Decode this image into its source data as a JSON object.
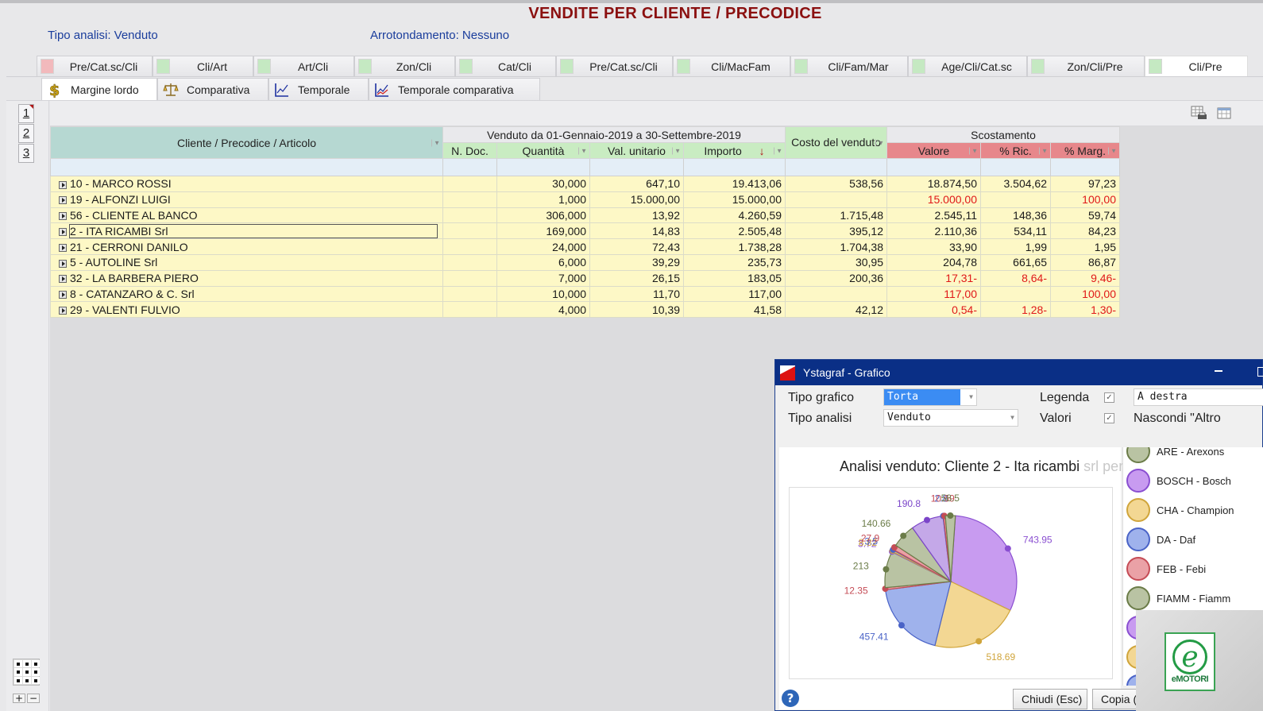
{
  "header": {
    "title": "VENDITE PER CLIENTE / PRECODICE",
    "tipo_analisi": "Tipo analisi: Venduto",
    "arrotondamento": "Arrotondamento: Nessuno"
  },
  "view_tabs": [
    {
      "label": "Pre/Cat.sc/Cli",
      "color": "#f2b9bc",
      "active": false
    },
    {
      "label": "Cli/Art",
      "color": "#c5e9c2",
      "active": false
    },
    {
      "label": "Art/Cli",
      "color": "#c5e9c2",
      "active": false
    },
    {
      "label": "Zon/Cli",
      "color": "#c5e9c2",
      "active": false
    },
    {
      "label": "Cat/Cli",
      "color": "#c5e9c2",
      "active": false
    },
    {
      "label": "Pre/Cat.sc/Cli",
      "color": "#c5e9c2",
      "active": false
    },
    {
      "label": "Cli/MacFam",
      "color": "#c5e9c2",
      "active": false
    },
    {
      "label": "Cli/Fam/Mar",
      "color": "#c5e9c2",
      "active": false
    },
    {
      "label": "Age/Cli/Cat.sc",
      "color": "#c5e9c2",
      "active": false
    },
    {
      "label": "Zon/Cli/Pre",
      "color": "#c5e9c2",
      "active": false
    },
    {
      "label": "Cli/Pre",
      "color": "#c5e9c2",
      "active": true
    }
  ],
  "analysis_tabs": [
    {
      "label": "Margine lordo",
      "icon": "dollar-icon",
      "active": true
    },
    {
      "label": "Comparativa",
      "icon": "scales-icon",
      "active": false
    },
    {
      "label": "Temporale",
      "icon": "line-chart-icon",
      "active": false
    },
    {
      "label": "Temporale comparativa",
      "icon": "comparative-chart-icon",
      "active": false
    }
  ],
  "levels": [
    "1",
    "2",
    "3"
  ],
  "toolbar": {
    "print_grid_icon": "print-grid-icon",
    "grid_layout_icon": "grid-layout-icon"
  },
  "table": {
    "group_headers": {
      "client": "Cliente / Precodice / Articolo",
      "venduto": "Venduto da 01-Gennaio-2019 a 30-Settembre-2019",
      "costo": "Costo del venduto",
      "scostamento": "Scostamento"
    },
    "columns": {
      "ndoc": "N. Doc.",
      "quantita": "Quantità",
      "val_unitario": "Val. unitario",
      "importo": "Importo",
      "valore": "Valore",
      "ric": "% Ric.",
      "marg": "% Marg."
    },
    "sort_indicator": "↓",
    "rows": [
      {
        "name": "10 - MARCO ROSSI",
        "ndoc": "",
        "quantita": "30,000",
        "val_unitario": "647,10",
        "importo": "19.413,06",
        "costo": "538,56",
        "valore": "18.874,50",
        "ric": "3.504,62",
        "marg": "97,23",
        "neg_valore": false,
        "neg_ric": false,
        "neg_marg": false,
        "focus": false
      },
      {
        "name": "19 - ALFONZI LUIGI",
        "ndoc": "",
        "quantita": "1,000",
        "val_unitario": "15.000,00",
        "importo": "15.000,00",
        "costo": "",
        "valore": "15.000,00",
        "ric": "",
        "marg": "100,00",
        "neg_valore": true,
        "neg_ric": false,
        "neg_marg": true,
        "focus": false
      },
      {
        "name": "56 - CLIENTE AL BANCO",
        "ndoc": "",
        "quantita": "306,000",
        "val_unitario": "13,92",
        "importo": "4.260,59",
        "costo": "1.715,48",
        "valore": "2.545,11",
        "ric": "148,36",
        "marg": "59,74",
        "neg_valore": false,
        "neg_ric": false,
        "neg_marg": false,
        "focus": false
      },
      {
        "name": "2 - ITA RICAMBI Srl",
        "ndoc": "",
        "quantita": "169,000",
        "val_unitario": "14,83",
        "importo": "2.505,48",
        "costo": "395,12",
        "valore": "2.110,36",
        "ric": "534,11",
        "marg": "84,23",
        "neg_valore": false,
        "neg_ric": false,
        "neg_marg": false,
        "focus": true
      },
      {
        "name": "21 - CERRONI DANILO",
        "ndoc": "",
        "quantita": "24,000",
        "val_unitario": "72,43",
        "importo": "1.738,28",
        "costo": "1.704,38",
        "valore": "33,90",
        "ric": "1,99",
        "marg": "1,95",
        "neg_valore": false,
        "neg_ric": false,
        "neg_marg": false,
        "focus": false
      },
      {
        "name": "5 - AUTOLINE Srl",
        "ndoc": "",
        "quantita": "6,000",
        "val_unitario": "39,29",
        "importo": "235,73",
        "costo": "30,95",
        "valore": "204,78",
        "ric": "661,65",
        "marg": "86,87",
        "neg_valore": false,
        "neg_ric": false,
        "neg_marg": false,
        "focus": false
      },
      {
        "name": "32 - LA BARBERA PIERO",
        "ndoc": "",
        "quantita": "7,000",
        "val_unitario": "26,15",
        "importo": "183,05",
        "costo": "200,36",
        "valore": "17,31-",
        "ric": "8,64-",
        "marg": "9,46-",
        "neg_valore": true,
        "neg_ric": true,
        "neg_marg": true,
        "focus": false
      },
      {
        "name": "8 - CATANZARO & C. Srl",
        "ndoc": "",
        "quantita": "10,000",
        "val_unitario": "11,70",
        "importo": "117,00",
        "costo": "",
        "valore": "117,00",
        "ric": "",
        "marg": "100,00",
        "neg_valore": true,
        "neg_ric": false,
        "neg_marg": true,
        "focus": false
      },
      {
        "name": "29 - VALENTI FULVIO",
        "ndoc": "",
        "quantita": "4,000",
        "val_unitario": "10,39",
        "importo": "41,58",
        "costo": "42,12",
        "valore": "0,54-",
        "ric": "1,28-",
        "marg": "1,30-",
        "neg_valore": true,
        "neg_ric": true,
        "neg_marg": true,
        "focus": false
      }
    ]
  },
  "dialog": {
    "title": "Ystagraf - Grafico",
    "tipo_grafico_label": "Tipo grafico",
    "tipo_grafico_value": "Torta",
    "tipo_analisi_label": "Tipo analisi",
    "tipo_analisi_value": "Venduto",
    "legenda_label": "Legenda",
    "legenda_checked": true,
    "legenda_position": "A destra",
    "valori_label": "Valori",
    "valori_checked": true,
    "nascondi_label": "Nascondi \"Altro",
    "close_button": "Chiudi (Esc)",
    "copy_button": "Copia (",
    "help_icon": "?"
  },
  "chart_data": {
    "type": "pie",
    "title": "Analisi venduto: Cliente 2 - Ita ricambi",
    "title_faded_suffix": "srl per Precodice",
    "legend_position": "right",
    "slices": [
      {
        "label": "BOSCH - Bosch",
        "value": 743.95,
        "color": "#c89bf0",
        "stroke": "#8a4fd1"
      },
      {
        "label": "CHA - Champion",
        "value": 518.69,
        "color": "#f3d793",
        "stroke": "#d0a53b"
      },
      {
        "label": "DA - Daf",
        "value": 457.41,
        "color": "#9fb2ec",
        "stroke": "#4a63c7"
      },
      {
        "label": "FEB - Febi",
        "value": 12.35,
        "color": "#eaa1a6",
        "stroke": "#c54c56"
      },
      {
        "label": "FIAMM - Fiamm",
        "value": 213,
        "color": "#b9c3a3",
        "stroke": "#6b7c48"
      },
      {
        "label": "",
        "value": 3.72,
        "color": "#c89bf0",
        "stroke": "#8a4fd1"
      },
      {
        "label": "",
        "value": 8.82,
        "color": "#f3d793",
        "stroke": "#d0a53b"
      },
      {
        "label": "",
        "value": 3.5,
        "color": "#9fb2ec",
        "stroke": "#4a63c7"
      },
      {
        "label": "",
        "value": 27.9,
        "color": "#eaa1a6",
        "stroke": "#c54c56"
      },
      {
        "label": "",
        "value": 140.66,
        "color": "#b9c3a3",
        "stroke": "#6b7c48"
      },
      {
        "label": "",
        "value": 190.8,
        "color": "#c4a8e8",
        "stroke": "#7b45c9"
      },
      {
        "label": "",
        "value": 2.8,
        "color": "#9fb2ec",
        "stroke": "#4a63c7"
      },
      {
        "label": "",
        "value": 10.69,
        "color": "#eaa1a6",
        "stroke": "#c54c56"
      },
      {
        "label": "ARE - Arexons",
        "value": 58.5,
        "color": "#b9c3a3",
        "stroke": "#6b7c48"
      }
    ],
    "value_labels": [
      "743.95",
      "518.69",
      "457.41",
      "12.35",
      "213",
      "3",
      "8.82",
      "27.9",
      "10",
      "140.66",
      "190.8",
      "2",
      "10",
      "69",
      "58.5"
    ],
    "legend": [
      {
        "label": "ARE - Arexons",
        "color": "#b9c3a3",
        "stroke": "#6b7c48"
      },
      {
        "label": "BOSCH - Bosch",
        "color": "#c89bf0",
        "stroke": "#8a4fd1"
      },
      {
        "label": "CHA - Champion",
        "color": "#f3d793",
        "stroke": "#d0a53b"
      },
      {
        "label": "DA - Daf",
        "color": "#9fb2ec",
        "stroke": "#4a63c7"
      },
      {
        "label": "FEB - Febi",
        "color": "#eaa1a6",
        "stroke": "#c54c56"
      },
      {
        "label": "FIAMM - Fiamm",
        "color": "#b9c3a3",
        "stroke": "#6b7c48"
      },
      {
        "label": "",
        "color": "#c89bf0",
        "stroke": "#8a4fd1"
      },
      {
        "label": "",
        "color": "#f3d793",
        "stroke": "#d0a53b"
      },
      {
        "label": "",
        "color": "#9fb2ec",
        "stroke": "#4a63c7"
      }
    ]
  },
  "watermark": {
    "brand": "eMOTORI",
    "letter": "e"
  }
}
